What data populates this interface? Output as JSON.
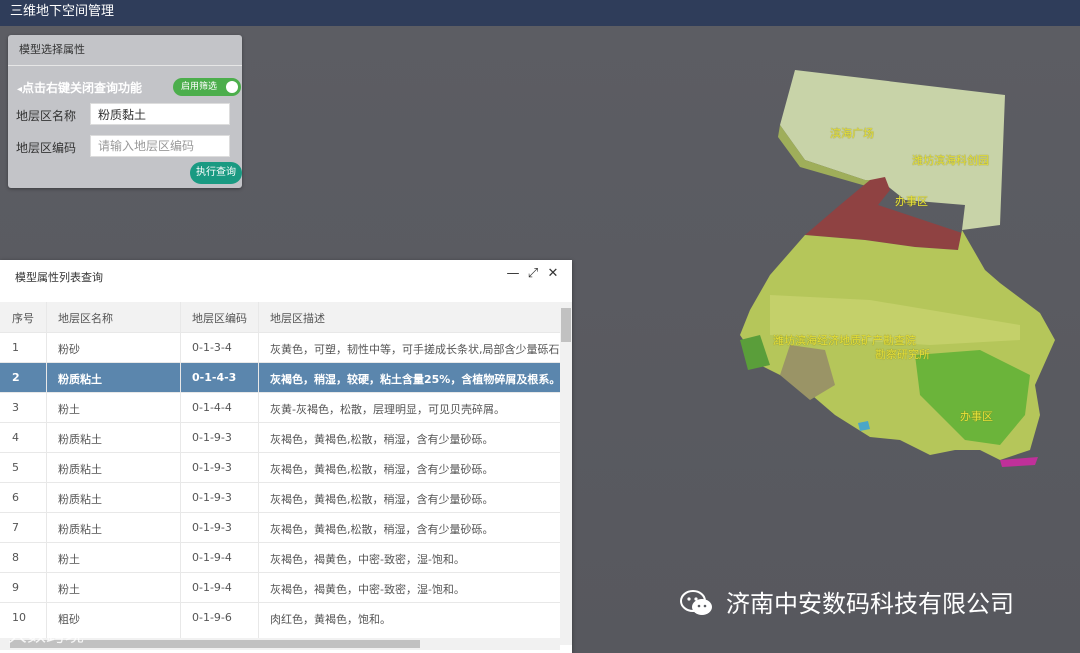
{
  "app": {
    "title": "三维地下空间管理"
  },
  "query_panel": {
    "title": "模型选择属性",
    "tip": "点击右键关闭查询功能",
    "toggle_label": "启用筛选",
    "name_label": "地层区名称",
    "name_value": "粉质黏土",
    "code_label": "地层区编码",
    "code_placeholder": "请输入地层区编码",
    "submit_label": "执行查询"
  },
  "table_window": {
    "title": "模型属性列表查询",
    "columns": [
      "序号",
      "地层区名称",
      "地层区编码",
      "地层区描述"
    ],
    "selected_index": 1,
    "rows": [
      {
        "no": "1",
        "name": "粉砂",
        "code": "0-1-3-4",
        "desc": "灰黄色，可塑，韧性中等，可手搓成长条状,局部含少量砾石,"
      },
      {
        "no": "2",
        "name": "粉质粘土",
        "code": "0-1-4-3",
        "desc": "灰褐色，稍湿，较硬，粘土含量25%，含植物碎屑及根系。"
      },
      {
        "no": "3",
        "name": "粉土",
        "code": "0-1-4-4",
        "desc": "灰黄-灰褐色，松散，层理明显，可见贝壳碎屑。"
      },
      {
        "no": "4",
        "name": "粉质粘土",
        "code": "0-1-9-3",
        "desc": "灰褐色，黄褐色,松散，稍湿，含有少量砂砾。"
      },
      {
        "no": "5",
        "name": "粉质粘土",
        "code": "0-1-9-3",
        "desc": "灰褐色，黄褐色,松散，稍湿，含有少量砂砾。"
      },
      {
        "no": "6",
        "name": "粉质粘土",
        "code": "0-1-9-3",
        "desc": "灰褐色，黄褐色,松散，稍湿，含有少量砂砾。"
      },
      {
        "no": "7",
        "name": "粉质粘土",
        "code": "0-1-9-3",
        "desc": "灰褐色，黄褐色,松散，稍湿，含有少量砂砾。"
      },
      {
        "no": "8",
        "name": "粉土",
        "code": "0-1-9-4",
        "desc": "灰褐色，褐黄色，中密-致密，湿-饱和。"
      },
      {
        "no": "9",
        "name": "粉土",
        "code": "0-1-9-4",
        "desc": "灰褐色，褐黄色，中密-致密，湿-饱和。"
      },
      {
        "no": "10",
        "name": "粗砂",
        "code": "0-1-9-6",
        "desc": "肉红色，黄褐色，饱和。"
      }
    ]
  },
  "map_labels": [
    "滨海广场",
    "潍坊滨海科创园",
    "办事区",
    "潍坊滨海经济地质矿产勘查院",
    "勘察研究所",
    "办事区"
  ],
  "brand": "济南中安数码科技有限公司",
  "watermark": "大数跨境",
  "colors": {
    "topbar": "#2f3d5a",
    "selected_row": "#5b86ad",
    "toggle": "#4cae4c",
    "submit": "#1a9a82"
  }
}
